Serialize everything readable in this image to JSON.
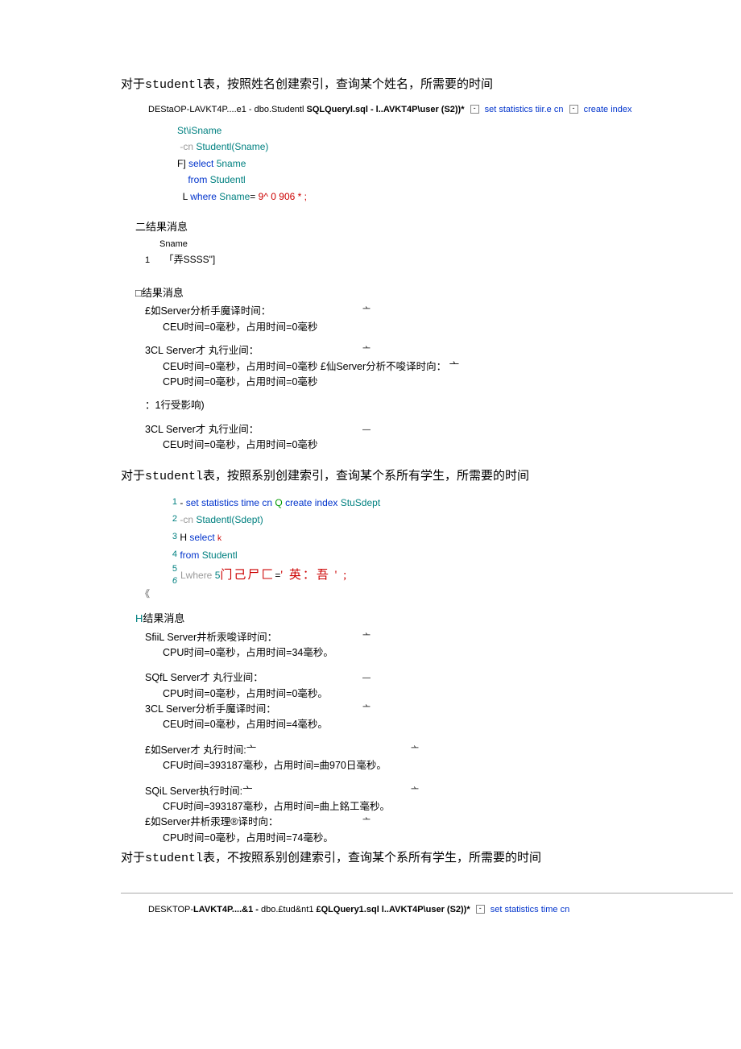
{
  "section1": {
    "heading_pre": "对于",
    "heading_mono": "studentl",
    "heading_post": "表，按照姓名创建索引，查询某个姓名，所需要的时间",
    "tabs": "DEStaOP-LAVKT4P....e1 - dbo.Studentl",
    "tabs_bold": " SQLQueryl.sql - l..AVKT4P\\user (S2))*",
    "tabs_after1": "set statistics tiir.e cn",
    "tabs_after2": "create index",
    "code": {
      "l1": "St\\iSname",
      "l2_a": " -cn ",
      "l2_b": "Studentl(Sname)",
      "l3_a": "F] ",
      "l3_b": "select ",
      "l3_c": "5name",
      "l4_a": "    from ",
      "l4_b": "Studentl",
      "l5_a": "  L ",
      "l5_b": "where ",
      "l5_c": "Sname",
      "l5_d": "= ",
      "l5_e": "9^ 0 906 * ;"
    },
    "res_hdr": "二结果消息",
    "res_col": "Sname",
    "res_row_n": "1",
    "res_row_v": "「弄SSSS\"]",
    "msg_hdr": "□结果消息",
    "msg": {
      "a1": "£如Server分析手魔译时间：",
      "a2": "CEU时间=0毫秒，占用时间=0毫秒",
      "b1": "3CL Server才 丸行业间：",
      "b2": "CEU时间=0毫秒，占用时间=0毫秒  £仙Server分析不唆译时向：  亠",
      "b3": "CPU时间=0毫秒，占用时间=0毫秒",
      "c1": "：1行受影响)",
      "d1": "3CL Server才 丸行业间：",
      "d2": "CEU时间=0毫秒，占用时间=0毫秒"
    }
  },
  "section2": {
    "heading_pre": "对于",
    "heading_mono": "studentl",
    "heading_post": "表，按照系别创建索引，查询某个系所有学生，所需要的时间",
    "code": {
      "l1_a": "set statistics time cn ",
      "l1_b": "Q ",
      "l1_c": "create index ",
      "l1_d": "StuSdept",
      "l2_a": "-cn ",
      "l2_b": "Stadentl(Sdept)",
      "l3_a": "H ",
      "l3_b": "select ",
      "l3_c": "k",
      "l4_a": "   from ",
      "l4_b": "Studentl",
      "l56_a": "Lwhere ",
      "l56_b": "5",
      "l56_c": "门己尸匚",
      "l56_d": "=",
      "l56_e": "' 英：吾 ' ;"
    },
    "res_hdr": "H结果消息",
    "msg": {
      "a1": "SfiiL Server井析汞唆译时间：",
      "a2": "CPU时间=0毫秒，占用时间=34毫秒。",
      "b1": "SQfL Server才 丸行业间：",
      "b2": "CPU时间=0毫秒，占用时间=0毫秒。",
      "c1": "3CL Server分析手魔译时间：",
      "c2": "CEU时间=0毫秒，占用时间=4毫秒。",
      "d1": "£如Server才 丸行时间:亠",
      "d2": "CFU时间=393187毫秒，占用时间=曲970日毫秒。",
      "e1": "SQiL Server执行时间:亠",
      "e2": "CFU时间=393187毫秒，占用时间=曲上銘工毫秒。",
      "f1": "£如Server井析汞理®译时向：",
      "f2": "CPU时间=0毫秒，占用时间=74毫秒。"
    }
  },
  "section3": {
    "heading_pre": "对于",
    "heading_mono": "studentl",
    "heading_post": "表，不按照系别创建索引，查询某个系所有学生，所需要的时间",
    "tabs": "DESKTOP-",
    "tabs_b1": "LAVKT4P....&1 - ",
    "tabs_mid": "dbo.£tud&nt1 ",
    "tabs_b2": "£QLQuery1.sql l..AVKT4P\\user (S2))*",
    "tabs_after": "set statistics time cn"
  },
  "glyphs": {
    "minus": "—",
    "dash": "—",
    "caret_down": "亠"
  }
}
